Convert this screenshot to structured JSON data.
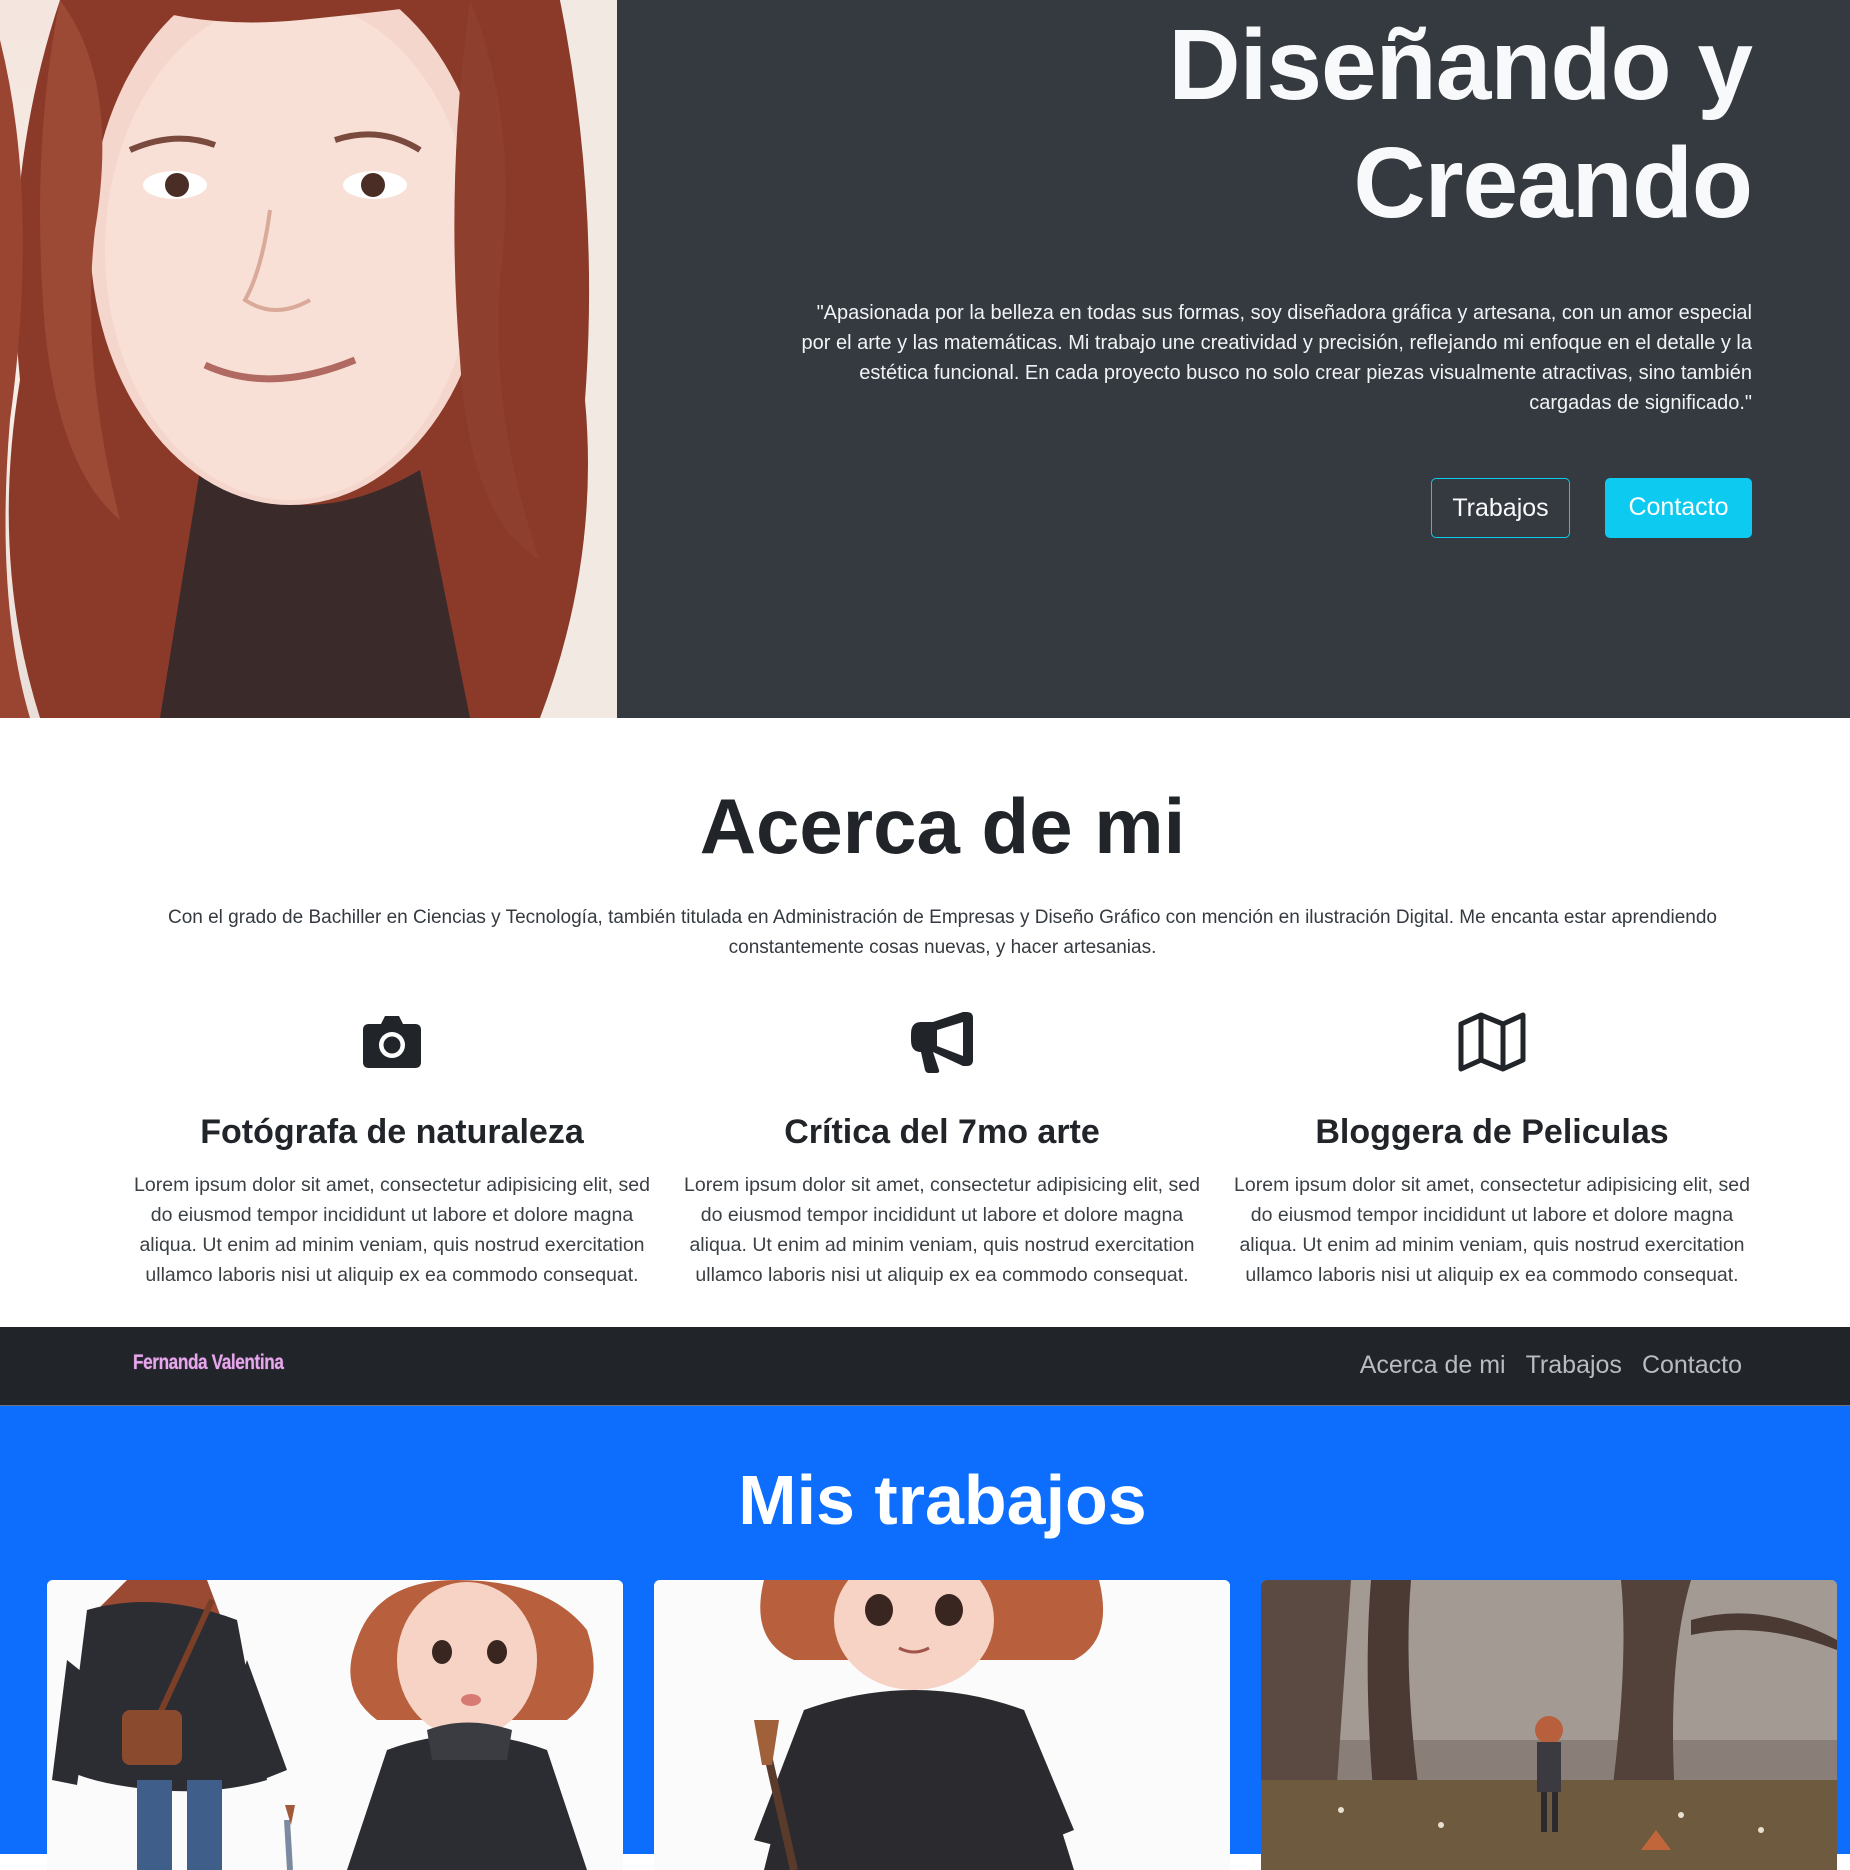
{
  "hero": {
    "title_line1": "Diseñando y",
    "title_line2": "Creando",
    "quote": "\"Apasionada por la belleza en todas sus formas, soy diseñadora gráfica y artesana, con un amor especial por el arte y las matemáticas. Mi trabajo une creatividad y precisión, reflejando mi enfoque en el detalle y la estética funcional. En cada proyecto busco no solo crear piezas visualmente atractivas, sino también cargadas de significado.\"",
    "buttons": {
      "trabajos": "Trabajos",
      "contacto": "Contacto"
    },
    "accent_color": "#0dcaf0",
    "background_color": "#343a40"
  },
  "about": {
    "title": "Acerca de mi",
    "text": "Con el grado de Bachiller en Ciencias y Tecnología, también titulada en Administración de Empresas y Diseño Gráfico con mención en ilustración Digital. Me encanta estar aprendiendo constantemente cosas nuevas, y hacer artesanias.",
    "features": [
      {
        "icon": "camera-icon",
        "title": "Fotógrafa de naturaleza",
        "text": "Lorem ipsum dolor sit amet, consectetur adipisicing elit, sed do eiusmod tempor incididunt ut labore et dolore magna aliqua. Ut enim ad minim veniam, quis nostrud exercitation ullamco laboris nisi ut aliquip ex ea commodo consequat."
      },
      {
        "icon": "megaphone-icon",
        "title": "Crítica del 7mo arte",
        "text": "Lorem ipsum dolor sit amet, consectetur adipisicing elit, sed do eiusmod tempor incididunt ut labore et dolore magna aliqua. Ut enim ad minim veniam, quis nostrud exercitation ullamco laboris nisi ut aliquip ex ea commodo consequat."
      },
      {
        "icon": "map-icon",
        "title": "Bloggera de Peliculas",
        "text": "Lorem ipsum dolor sit amet, consectetur adipisicing elit, sed do eiusmod tempor incididunt ut labore et dolore magna aliqua. Ut enim ad minim veniam, quis nostrud exercitation ullamco laboris nisi ut aliquip ex ea commodo consequat."
      }
    ]
  },
  "navbar": {
    "brand": "Fernanda Valentina",
    "brand_color": "#e6a8ea",
    "links": [
      "Acerca de mi",
      "Trabajos",
      "Contacto"
    ]
  },
  "works": {
    "title": "Mis trabajos",
    "background_color": "#0d6efd",
    "cards": [
      {
        "image": "illustration-two-girls-sweaters"
      },
      {
        "image": "illustration-girl-with-paintbrush"
      },
      {
        "image": "illustration-girl-in-autumn-forest"
      }
    ]
  }
}
